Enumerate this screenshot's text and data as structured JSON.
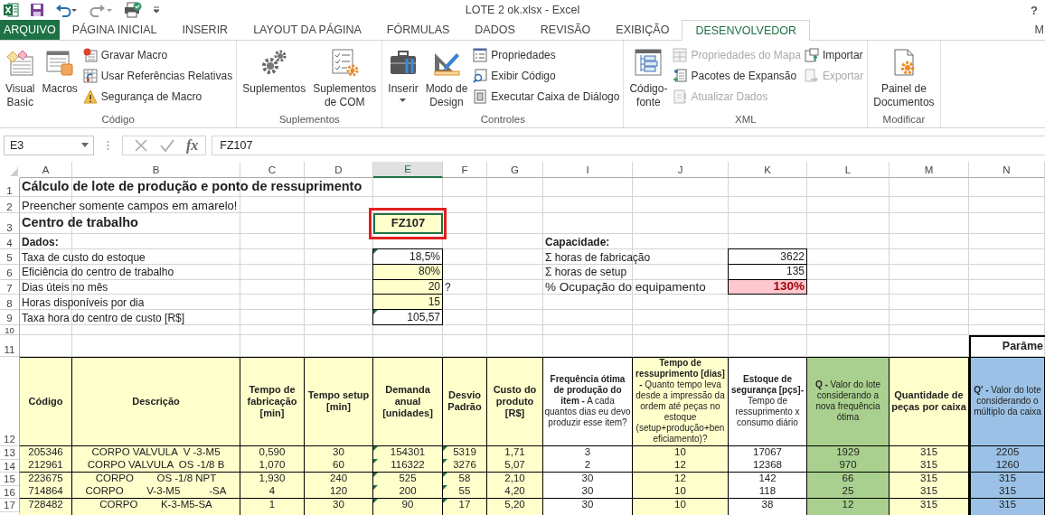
{
  "title_bar": {
    "title": "LOTE 2 ok.xlsx - Excel",
    "help": "?"
  },
  "tabs": [
    {
      "label": "ARQUIVO",
      "kind": "file",
      "selected": false
    },
    {
      "label": "PÁGINA INICIAL",
      "kind": "tab",
      "selected": false
    },
    {
      "label": "INSERIR",
      "kind": "tab",
      "selected": false
    },
    {
      "label": "LAYOUT DA PÁGINA",
      "kind": "tab",
      "selected": false
    },
    {
      "label": "FÓRMULAS",
      "kind": "tab",
      "selected": false
    },
    {
      "label": "DADOS",
      "kind": "tab",
      "selected": false
    },
    {
      "label": "REVISÃO",
      "kind": "tab",
      "selected": false
    },
    {
      "label": "EXIBIÇÃO",
      "kind": "tab",
      "selected": false
    },
    {
      "label": "DESENVOLVEDOR",
      "kind": "tab",
      "selected": true
    }
  ],
  "account": "M",
  "ribbon": {
    "groups": [
      {
        "label": "Código",
        "items": [
          {
            "kind": "large",
            "label": "Visual\nBasic",
            "dropdown": false
          },
          {
            "kind": "large",
            "label": "Macros",
            "dropdown": false
          },
          {
            "kind": "column",
            "items": [
              {
                "label": "Gravar Macro",
                "disabled": false
              },
              {
                "label": "Usar Referências Relativas",
                "disabled": false
              },
              {
                "label": "Segurança de Macro",
                "disabled": false
              }
            ]
          }
        ]
      },
      {
        "label": "Suplementos",
        "items": [
          {
            "kind": "large",
            "label": "Suplementos",
            "dropdown": false
          },
          {
            "kind": "large",
            "label": "Suplementos\nde COM",
            "dropdown": false
          }
        ]
      },
      {
        "label": "Controles",
        "items": [
          {
            "kind": "large",
            "label": "Inserir",
            "dropdown": true
          },
          {
            "kind": "large",
            "label": "Modo de\nDesign",
            "dropdown": false
          },
          {
            "kind": "column",
            "items": [
              {
                "label": "Propriedades",
                "disabled": false
              },
              {
                "label": "Exibir Código",
                "disabled": false
              },
              {
                "label": "Executar Caixa de Diálogo",
                "disabled": false
              }
            ]
          }
        ]
      },
      {
        "label": "XML",
        "items": [
          {
            "kind": "large",
            "label": "Código-\nfonte",
            "dropdown": false
          },
          {
            "kind": "column",
            "items": [
              {
                "label": "Propriedades do Mapa",
                "disabled": true
              },
              {
                "label": "Pacotes de Expansão",
                "disabled": false
              },
              {
                "label": "Atualizar Dados",
                "disabled": true
              }
            ]
          },
          {
            "kind": "column",
            "items": [
              {
                "label": "Importar",
                "disabled": false
              },
              {
                "label": "Exportar",
                "disabled": true
              }
            ]
          }
        ]
      },
      {
        "label": "Modificar",
        "items": [
          {
            "kind": "large",
            "label": "Painel de\nDocumentos",
            "dropdown": false
          }
        ]
      }
    ]
  },
  "formula_bar": {
    "name_box": "E3",
    "function_label": "fx",
    "formula": "FZ107"
  },
  "sheet": {
    "columns": [
      {
        "label": "A",
        "selected": false
      },
      {
        "label": "B",
        "selected": false
      },
      {
        "label": "C",
        "selected": false
      },
      {
        "label": "D",
        "selected": false
      },
      {
        "label": "E",
        "selected": true
      },
      {
        "label": "F",
        "selected": false
      },
      {
        "label": "G",
        "selected": false
      },
      {
        "label": "I",
        "selected": false
      },
      {
        "label": "J",
        "selected": false
      },
      {
        "label": "K",
        "selected": false
      },
      {
        "label": "L",
        "selected": false
      },
      {
        "label": "M",
        "selected": false
      },
      {
        "label": "N",
        "selected": false
      }
    ],
    "row_numbers": [
      "1",
      "2",
      "3",
      "4",
      "5",
      "6",
      "7",
      "8",
      "9",
      "10",
      "11",
      "12",
      "13",
      "14",
      "15",
      "16",
      "17"
    ],
    "title": "Cálculo de lote de produção e ponto de ressuprimento",
    "subtitle": "Preencher somente campos em amarelo!",
    "work_center": {
      "label": "Centro de trabalho",
      "value": "FZ107",
      "selected": true,
      "marked": true
    },
    "data": {
      "heading": "Dados:",
      "rows": [
        {
          "label": "Taxa de custo do estoque",
          "value": "18,5%",
          "input": false,
          "flagged": true
        },
        {
          "label": "Eficiência do centro de trabalho",
          "value": "80%",
          "input": true,
          "flagged": false
        },
        {
          "label": "Dias úteis no mês",
          "value": "20",
          "input": true,
          "flagged": false,
          "note": "?"
        },
        {
          "label": "Horas disponíveis por dia",
          "value": "15",
          "input": true,
          "flagged": false
        },
        {
          "label": "Taxa hora do centro de custo [R$]",
          "value": "105,57",
          "input": false,
          "flagged": true
        }
      ]
    },
    "capacity": {
      "heading": "Capacidade:",
      "rows": [
        {
          "label": "Σ horas de fabricação",
          "value": "3622",
          "alert": false
        },
        {
          "label": "Σ horas de setup",
          "value": "135",
          "alert": false
        },
        {
          "label": "% Ocupação do equipamento",
          "value": "130%",
          "alert": true
        }
      ]
    },
    "table": {
      "section_header": "Parâme",
      "columns": [
        {
          "header": "Código",
          "bold": true,
          "color": "#ffffcc",
          "flagged": false
        },
        {
          "header": "Descrição",
          "bold": true,
          "color": "#ffffcc",
          "flagged": false
        },
        {
          "header": "Tempo de fabricação [min]",
          "bold": true,
          "color": "#ffffcc",
          "flagged": false
        },
        {
          "header": "Tempo setup [min]",
          "bold": true,
          "color": "#ffffcc",
          "flagged": false
        },
        {
          "header": "Demanda anual [unidades]",
          "bold": true,
          "color": "#ffffcc",
          "flagged": true
        },
        {
          "header": "Desvio Padrão",
          "bold": true,
          "color": "#ffffcc",
          "flagged": true
        },
        {
          "header": "Custo do produto [R$]",
          "bold": true,
          "color": "#ffffcc",
          "flagged": false
        },
        {
          "header": "**Frequência ótima de produção do item -** A cada quantos dias eu devo produzir esse item?",
          "bold": false,
          "color": "#ffffff",
          "flagged": false
        },
        {
          "header": "**Tempo de ressuprimento [dias] -** Quanto tempo leva desde a impressão da ordem até peças no estoque (setup+produção+beneficiamento)?",
          "bold": false,
          "color": "#ffffcc",
          "flagged": false
        },
        {
          "header": "**Estoque de segurança [pçs]-** Tempo de ressuprimento x consumo diário",
          "bold": false,
          "color": "#ffffff",
          "flagged": false
        },
        {
          "header": "**Q -** Valor do lote considerando a nova frequência ótima",
          "bold": false,
          "color": "#a9d08e",
          "flagged": false
        },
        {
          "header": "Quantidade de peças por caixa",
          "bold": true,
          "color": "#ffffcc",
          "flagged": false
        },
        {
          "header": "**Q' -** Valor do lote considerando o múltiplo da caixa",
          "bold": false,
          "color": "#9bc2e6",
          "flagged": false
        }
      ],
      "rows": [
        [
          "205346",
          "CORPO VALVULA  V -3-M5",
          "0,590",
          "30",
          "154301",
          "5319",
          "1,71",
          "3",
          "10",
          "17067",
          "1929",
          "315",
          "2205"
        ],
        [
          "212961",
          "CORPO VALVULA  OS -1/8 B",
          "1,070",
          "60",
          "116322",
          "3276",
          "5,07",
          "2",
          "12",
          "12368",
          "970",
          "315",
          "1260"
        ],
        [
          "223675",
          "CORPO        OS -1/8 NPT",
          "1,930",
          "240",
          "525",
          "58",
          "2,10",
          "30",
          "12",
          "142",
          "66",
          "315",
          "315"
        ],
        [
          "714864",
          "CORPO        V-3-M5          -SA",
          "4",
          "120",
          "200",
          "55",
          "4,20",
          "30",
          "10",
          "118",
          "25",
          "315",
          "315"
        ],
        [
          "728482",
          "CORPO        K-3-M5-SA",
          "1",
          "30",
          "90",
          "17",
          "5,20",
          "30",
          "10",
          "38",
          "12",
          "315",
          "315"
        ]
      ]
    }
  }
}
